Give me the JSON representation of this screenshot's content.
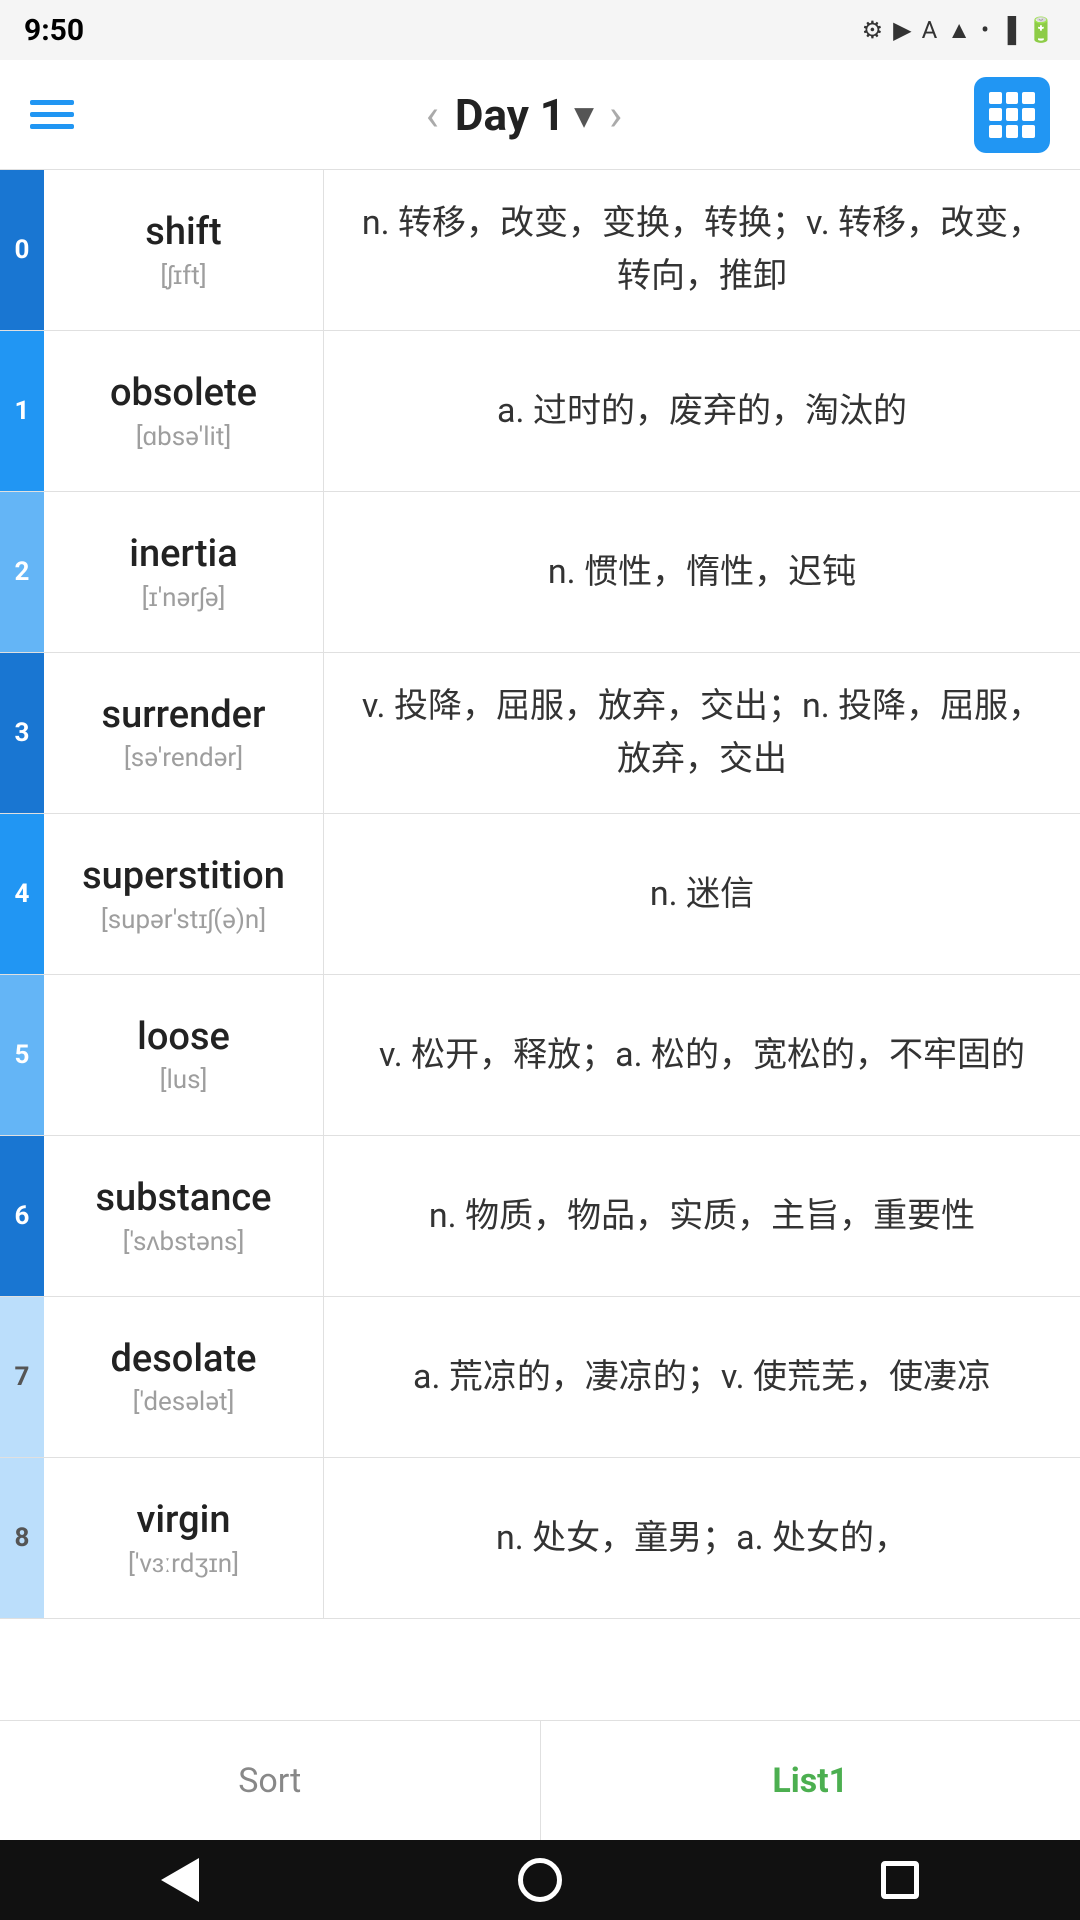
{
  "statusBar": {
    "time": "9:50",
    "icons": [
      "settings",
      "play",
      "A",
      "wifi",
      "signal",
      "battery"
    ]
  },
  "nav": {
    "title": "Day 1",
    "titleChevron": "▾",
    "prevLabel": "‹",
    "nextLabel": "›"
  },
  "words": [
    {
      "index": "0",
      "colorClass": "blue-dark",
      "word": "shift",
      "phonetic": "[ʃɪft]",
      "definition": "n. 转移，改变，变换，转换；v. 转移，改变，转向，推卸"
    },
    {
      "index": "1",
      "colorClass": "blue-mid",
      "word": "obsolete",
      "phonetic": "[ɑbsə'lit]",
      "definition": "a. 过时的，废弃的，淘汰的"
    },
    {
      "index": "2",
      "colorClass": "blue-light",
      "word": "inertia",
      "phonetic": "[ɪ'nərʃə]",
      "definition": "n. 惯性，惰性，迟钝"
    },
    {
      "index": "3",
      "colorClass": "blue-dark",
      "word": "surrender",
      "phonetic": "[sə'rendər]",
      "definition": "v. 投降，屈服，放弃，交出；n. 投降，屈服，放弃，交出"
    },
    {
      "index": "4",
      "colorClass": "blue-mid",
      "word": "superstition",
      "phonetic": "[supər'stɪʃ(ə)n]",
      "definition": "n. 迷信"
    },
    {
      "index": "5",
      "colorClass": "blue-light",
      "word": "loose",
      "phonetic": "[lus]",
      "definition": "v. 松开，释放；a. 松的，宽松的，不牢固的"
    },
    {
      "index": "6",
      "colorClass": "blue-dark",
      "word": "substance",
      "phonetic": "['sʌbstəns]",
      "definition": "n. 物质，物品，实质，主旨，重要性"
    },
    {
      "index": "7",
      "colorClass": "blue-pale",
      "word": "desolate",
      "phonetic": "['desələt]",
      "definition": "a. 荒凉的，凄凉的；v. 使荒芜，使凄凉"
    },
    {
      "index": "8",
      "colorClass": "blue-pale",
      "word": "virgin",
      "phonetic": "['vɜːrdʒɪn]",
      "definition": "n. 处女，童男；a. 处女的，"
    }
  ],
  "bottomTabs": [
    {
      "label": "Sort",
      "active": false
    },
    {
      "label": "List1",
      "active": true
    }
  ],
  "sysNav": {
    "back": "back",
    "home": "home",
    "recent": "recent"
  }
}
